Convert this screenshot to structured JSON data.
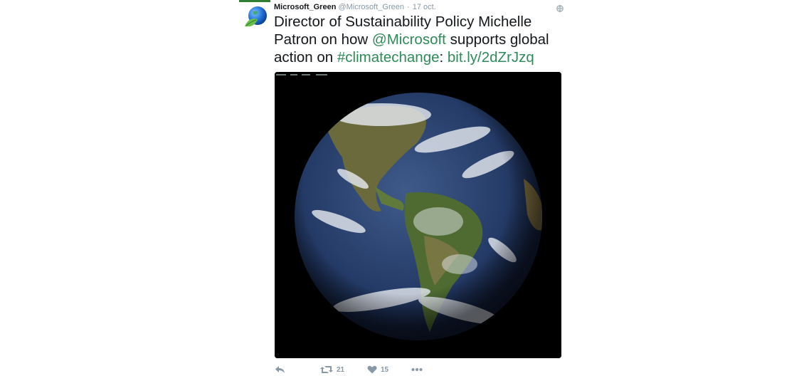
{
  "tweet": {
    "author_name": "Microsoft_Green",
    "author_handle": "@Microsoft_Green",
    "separator": "·",
    "date": "17 oct.",
    "text_parts": {
      "p1": "Director of Sustainability Policy Michelle Patron on how ",
      "mention": "@Microsoft",
      "p2": " supports global action on ",
      "hashtag": "#climatechange",
      "p3": ": ",
      "url": "bit.ly/2dZrJzq"
    },
    "image_alt": "Satellite image of Earth showing the Americas"
  },
  "actions": {
    "retweet_count": "21",
    "like_count": "15"
  },
  "icons": {
    "avatar": "globe-leaf-avatar",
    "header_globe": "globe-icon",
    "reply": "reply-icon",
    "retweet": "retweet-icon",
    "like": "heart-icon",
    "more": "more-icon"
  },
  "colors": {
    "link": "#2e8b57",
    "muted": "#8899a6",
    "accent": "#2e7d32"
  }
}
